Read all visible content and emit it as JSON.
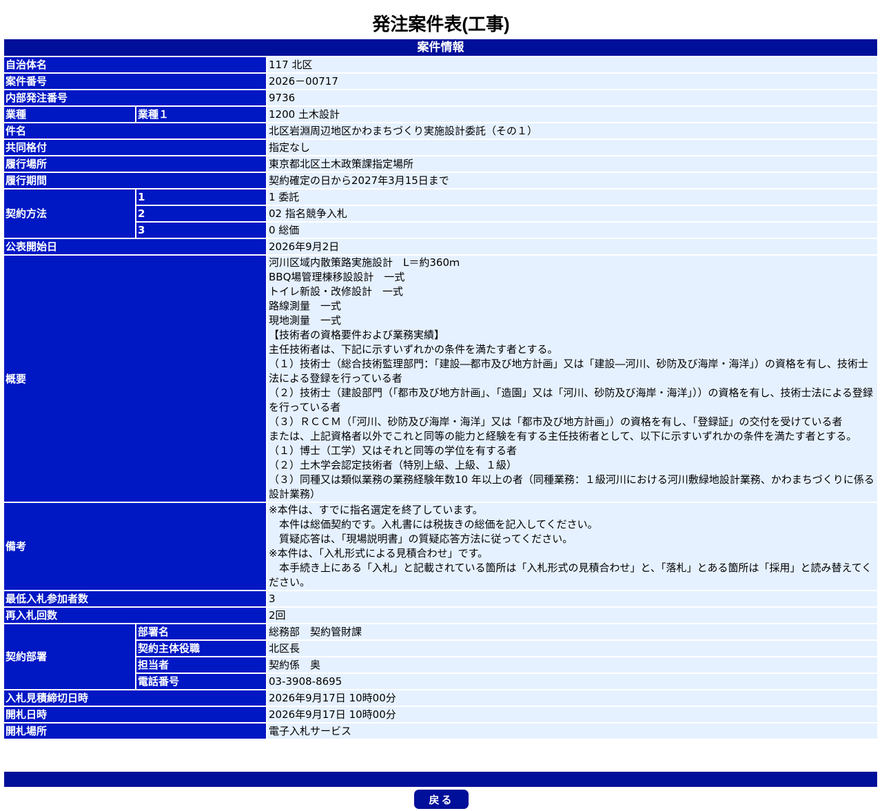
{
  "page_title": "発注案件表(工事)",
  "section_title": "案件情報",
  "rows": {
    "municipality": {
      "label": "自治体名",
      "value": "117 北区"
    },
    "case_number": {
      "label": "案件番号",
      "value": "2026－00717"
    },
    "internal_order_number": {
      "label": "内部発注番号",
      "value": "9736"
    },
    "industry": {
      "label": "業種",
      "sublabel": "業種１",
      "value": "1200 土木設計"
    },
    "subject": {
      "label": "件名",
      "value": "北区岩淵周辺地区かわまちづくり実施設計委託（その１）"
    },
    "joint_rating": {
      "label": "共同格付",
      "value": "指定なし"
    },
    "location": {
      "label": "履行場所",
      "value": "東京都北区土木政策課指定場所"
    },
    "period": {
      "label": "履行期間",
      "value": "契約確定の日から2027年3月15日まで"
    },
    "contract_method": {
      "label": "契約方法",
      "items": [
        {
          "sublabel": "1",
          "value": "1 委託"
        },
        {
          "sublabel": "2",
          "value": "02 指名競争入札"
        },
        {
          "sublabel": "3",
          "value": "0 総価"
        }
      ]
    },
    "publication_date": {
      "label": "公表開始日",
      "value": "2026年9月2日"
    },
    "overview": {
      "label": "概要",
      "lines": [
        "河川区域内散策路実施設計　L＝約360ｍ",
        "BBQ場管理棟移設設計　一式",
        "トイレ新設・改修設計　一式",
        "路線測量　一式",
        "現地測量　一式",
        "【技術者の資格要件および業務実績】",
        "主任技術者は、下記に示すいずれかの条件を満たす者とする。",
        "（１）技術士（総合技術監理部門：「建設―都市及び地方計画」又は「建設―河川、砂防及び海岸・海洋」）の資格を有し、技術士法による登録を行っている者",
        "（２）技術士（建設部門（「都市及び地方計画」、「造園」又は「河川、砂防及び海岸・海洋」））の資格を有し、技術士法による登録を行っている者",
        "（３）ＲＣＣＭ（「河川、砂防及び海岸・海洋」又は「都市及び地方計画」）の資格を有し、「登録証」の交付を受けている者",
        "または、上記資格者以外でこれと同等の能力と経験を有する主任技術者として、以下に示すいずれかの条件を満たす者とする。",
        "（１）博士（工学）又はそれと同等の学位を有する者",
        "（２）土木学会認定技術者（特別上級、上級、１級）",
        "（３）同種又は類似業務の業務経験年数10 年以上の者（同種業務：１級河川における河川敷緑地設計業務、かわまちづくりに係る設計業務）"
      ]
    },
    "remarks": {
      "label": "備考",
      "lines": [
        "※本件は、すでに指名選定を終了しています。",
        "　本件は総価契約です。入札書には税抜きの総価を記入してください。",
        "　質疑応答は、「現場説明書」の質疑応答方法に従ってください。",
        "※本件は、「入札形式による見積合わせ」です。",
        "　本手続き上にある「入札」と記載されている箇所は「入札形式の見積合わせ」と、「落札」とある箇所は「採用」と読み替えてください。"
      ]
    },
    "min_bidders": {
      "label": "最低入札参加者数",
      "value": "3"
    },
    "rebid_count": {
      "label": "再入札回数",
      "value": "2回"
    },
    "contract_department": {
      "label": "契約部署",
      "items": [
        {
          "sublabel": "部署名",
          "value": "総務部　契約管財課"
        },
        {
          "sublabel": "契約主体役職",
          "value": "北区長"
        },
        {
          "sublabel": "担当者",
          "value": "契約係　奥"
        },
        {
          "sublabel": "電話番号",
          "value": "03-3908-8695"
        }
      ]
    },
    "bid_deadline": {
      "label": "入札見積締切日時",
      "value": "2026年9月17日 10時00分"
    },
    "opening_datetime": {
      "label": "開札日時",
      "value": "2026年9月17日 10時00分"
    },
    "opening_location": {
      "label": "開札場所",
      "value": "電子入札サービス"
    }
  },
  "back_button_label": "戻る"
}
